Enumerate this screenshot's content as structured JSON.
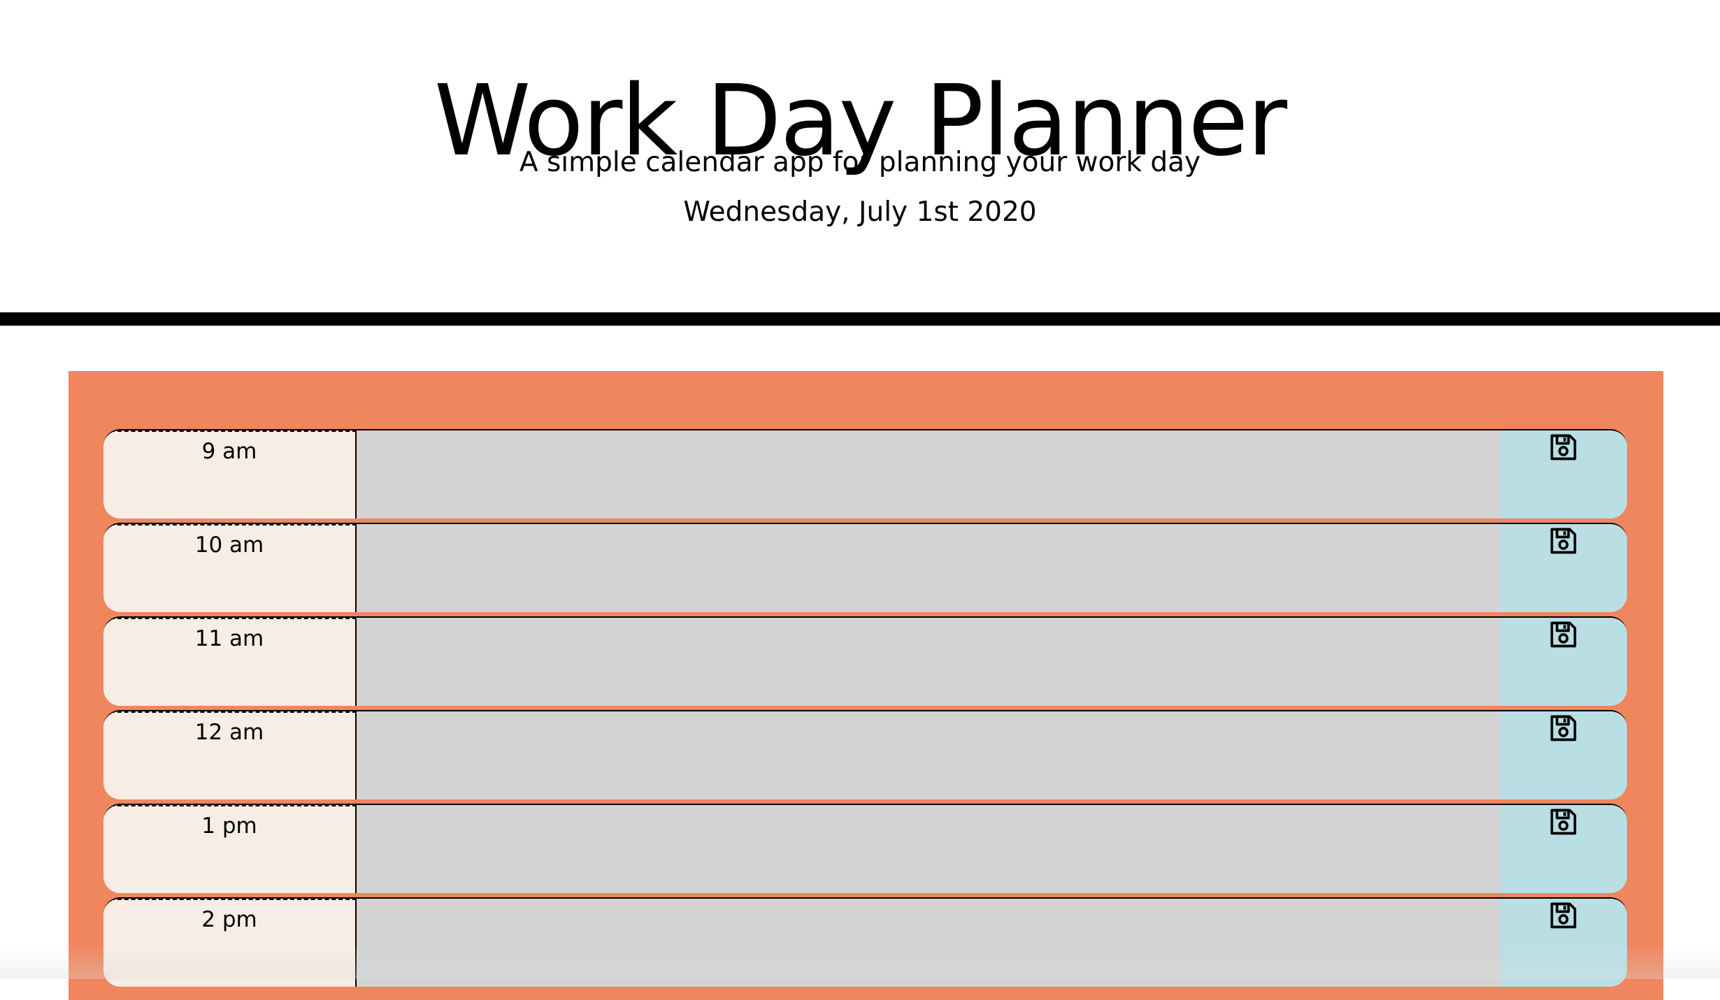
{
  "header": {
    "title": "Work Day Planner",
    "subtitle": "A simple calendar app for planning your work day",
    "current_date": "Wednesday, July 1st 2020"
  },
  "colors": {
    "container_bg": "#ef865e",
    "hour_bg": "#f7ede4",
    "past_event_bg": "#d3d3d3",
    "save_bg": "#b9dfe4",
    "divider": "#000000"
  },
  "timeblocks": [
    {
      "hour": "9 am",
      "event_text": "",
      "save_icon": "floppy-disk-icon"
    },
    {
      "hour": "10 am",
      "event_text": "",
      "save_icon": "floppy-disk-icon"
    },
    {
      "hour": "11 am",
      "event_text": "",
      "save_icon": "floppy-disk-icon"
    },
    {
      "hour": "12 am",
      "event_text": "",
      "save_icon": "floppy-disk-icon"
    },
    {
      "hour": "1 pm",
      "event_text": "",
      "save_icon": "floppy-disk-icon"
    },
    {
      "hour": "2 pm",
      "event_text": "",
      "save_icon": "floppy-disk-icon"
    }
  ]
}
